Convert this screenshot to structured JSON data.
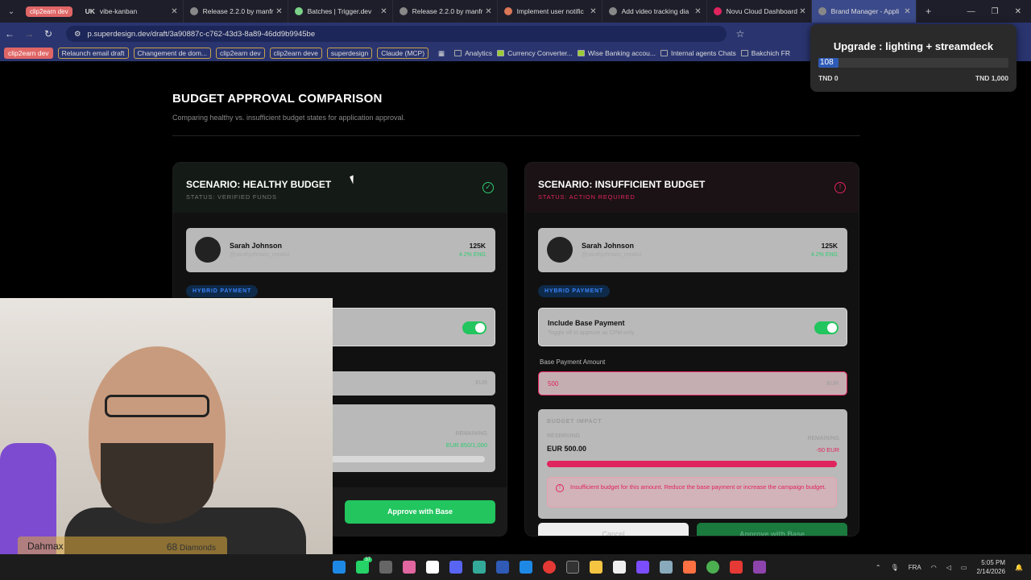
{
  "browser": {
    "group_chip": "clip2earn dev",
    "tabs": [
      {
        "label": "vibe-kanban",
        "prefix": "UK"
      },
      {
        "label": "Release 2.2.0 by manfr"
      },
      {
        "label": "Batches | Trigger.dev"
      },
      {
        "label": "Release 2.2.0 by manfr"
      },
      {
        "label": "Implement user notific"
      },
      {
        "label": "Add video tracking dia"
      },
      {
        "label": "Novu Cloud Dashboard"
      },
      {
        "label": "Brand Manager - Appli"
      }
    ],
    "url": "p.superdesign.dev/draft/3a90887c-c762-43d3-8a89-46dd9b9945be",
    "bookmarks": [
      "clip2earn dev",
      "Relaunch email draft",
      "Changement de dom...",
      "clip2earn dev",
      "clip2earn deve",
      "superdesign",
      "Claude (MCP)",
      "Analytics",
      "Currency Converter...",
      "Wise Banking accou...",
      "Internal agents Chats",
      "Bakchich FR",
      "rks"
    ]
  },
  "page": {
    "title": "BUDGET APPROVAL COMPARISON",
    "subtitle": "Comparing healthy vs. insufficient budget states for application approval."
  },
  "healthy": {
    "title": "SCENARIO: HEALTHY BUDGET",
    "status": "STATUS: VERIFIED FUNDS",
    "icon_glyph": "✓",
    "person_name": "Sarah Johnson",
    "person_handle": "@sarahjohnson_creator",
    "followers": "125K",
    "rate": "4.2% ENG",
    "badge": "HYBRID PAYMENT",
    "currency": "EUR",
    "remaining_label": "REMAINING",
    "remaining_value": "EUR 850/1,000",
    "progress": 0.08,
    "approve_label": "Approve with Base"
  },
  "insufficient": {
    "title": "SCENARIO: INSUFFICIENT BUDGET",
    "status": "STATUS: ACTION REQUIRED",
    "icon_glyph": "!",
    "person_name": "Sarah Johnson",
    "person_handle": "@sarahjohnson_creator",
    "followers": "125K",
    "rate": "4.2% ENG",
    "badge": "HYBRID PAYMENT",
    "include_label": "Include Base Payment",
    "include_hint": "Toggle off to approve as CPM-only.",
    "amount_label": "Base Payment Amount",
    "amount_value": "500",
    "currency": "EUR",
    "impact_title": "BUDGET IMPACT",
    "reserving_label": "RESERVING",
    "reserving_value": "EUR 500.00",
    "remaining_label": "REMAINING",
    "remaining_value": "-50 EUR",
    "progress": 1.0,
    "alert_text": "Insufficient budget for this amount. Reduce the base payment or increase the campaign budget.",
    "cancel_label": "Cancel",
    "approve_label": "Approve with Base"
  },
  "popup": {
    "title": "Upgrade : lighting + streamdeck",
    "value": "108",
    "min_label": "TND 0",
    "max_label": "TND 1,000",
    "progress": 0.108
  },
  "webcam": {
    "name": "Dahmax",
    "diamonds_count": "68",
    "diamonds_label": "Diamonds"
  },
  "taskbar": {
    "lang": "FRA",
    "time": "5:05 PM",
    "date": "2/14/2026",
    "badge_count": "37"
  },
  "colors": {
    "accent_green": "#22c55e",
    "accent_red": "#e0245e",
    "accent_blue": "#3b82f6"
  }
}
